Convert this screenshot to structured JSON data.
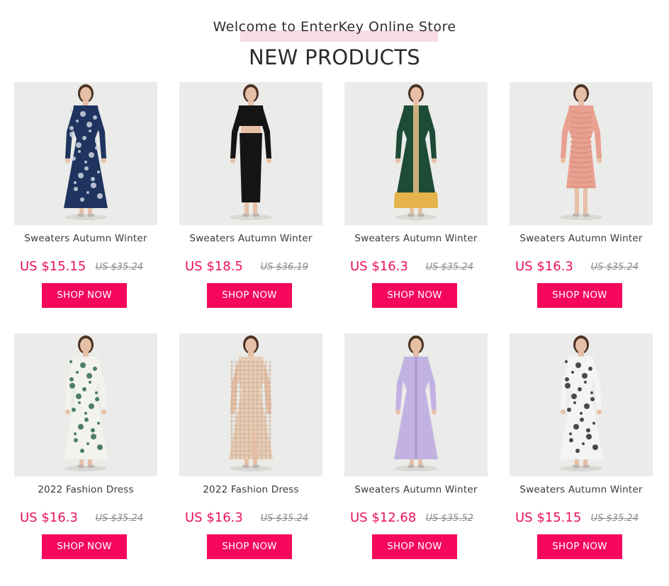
{
  "header": {
    "welcome_text": "Welcome to EnterKey Online Store",
    "section_title": "NEW PRODUCTS"
  },
  "colors": {
    "accent": "#f5075c",
    "price": "#e8105d",
    "underline": "#f7dbe5"
  },
  "products": [
    {
      "name": "Sweaters Autumn Winter",
      "price": "US $15.15",
      "old_price": "US $35.24",
      "button": "SHOP NOW",
      "image": "model in navy paisley long-sleeve maxi dress",
      "dress_color": "#1f3560",
      "accent_color": "#cfd6e4",
      "dress_style": "print"
    },
    {
      "name": "Sweaters Autumn Winter",
      "price": "US $18.5",
      "old_price": "US $36.19",
      "button": "SHOP NOW",
      "image": "model in black crop top and midi skirt set",
      "dress_color": "#151515",
      "accent_color": "#151515",
      "dress_style": "twopiece"
    },
    {
      "name": "Sweaters Autumn Winter",
      "price": "US $16.3",
      "old_price": "US $35.24",
      "button": "SHOP NOW",
      "image": "model in dark green maxi dress with yellow hem",
      "dress_color": "#1e4a38",
      "accent_color": "#e6b34a",
      "dress_style": "panel"
    },
    {
      "name": "Sweaters Autumn Winter",
      "price": "US $16.3",
      "old_price": "US $35.24",
      "button": "SHOP NOW",
      "image": "model in pink ruched bodycon dress",
      "dress_color": "#e8a091",
      "accent_color": "#d88b7c",
      "dress_style": "short"
    },
    {
      "name": "2022 Fashion Dress",
      "price": "US $16.3",
      "old_price": "US $35.24",
      "button": "SHOP NOW",
      "image": "model in green and white floral maxi dress",
      "dress_color": "#f2f2ee",
      "accent_color": "#2f6a4a",
      "dress_style": "print"
    },
    {
      "name": "2022 Fashion Dress",
      "price": "US $16.3",
      "old_price": "US $35.24",
      "button": "SHOP NOW",
      "image": "model in beige gingham smocked dress",
      "dress_color": "#e7cdb6",
      "accent_color": "#c7a98e",
      "dress_style": "slit"
    },
    {
      "name": "Sweaters Autumn Winter",
      "price": "US $12.68",
      "old_price": "US $35.52",
      "button": "SHOP NOW",
      "image": "model in lavender ruffled chiffon dress",
      "dress_color": "#c2b2e2",
      "accent_color": "#a896d4",
      "dress_style": "plain"
    },
    {
      "name": "Sweaters Autumn Winter",
      "price": "US $15.15",
      "old_price": "US $35.24",
      "button": "SHOP NOW",
      "image": "model in black and white paisley maxi dress",
      "dress_color": "#f4f4f4",
      "accent_color": "#2a2a2a",
      "dress_style": "print"
    }
  ]
}
